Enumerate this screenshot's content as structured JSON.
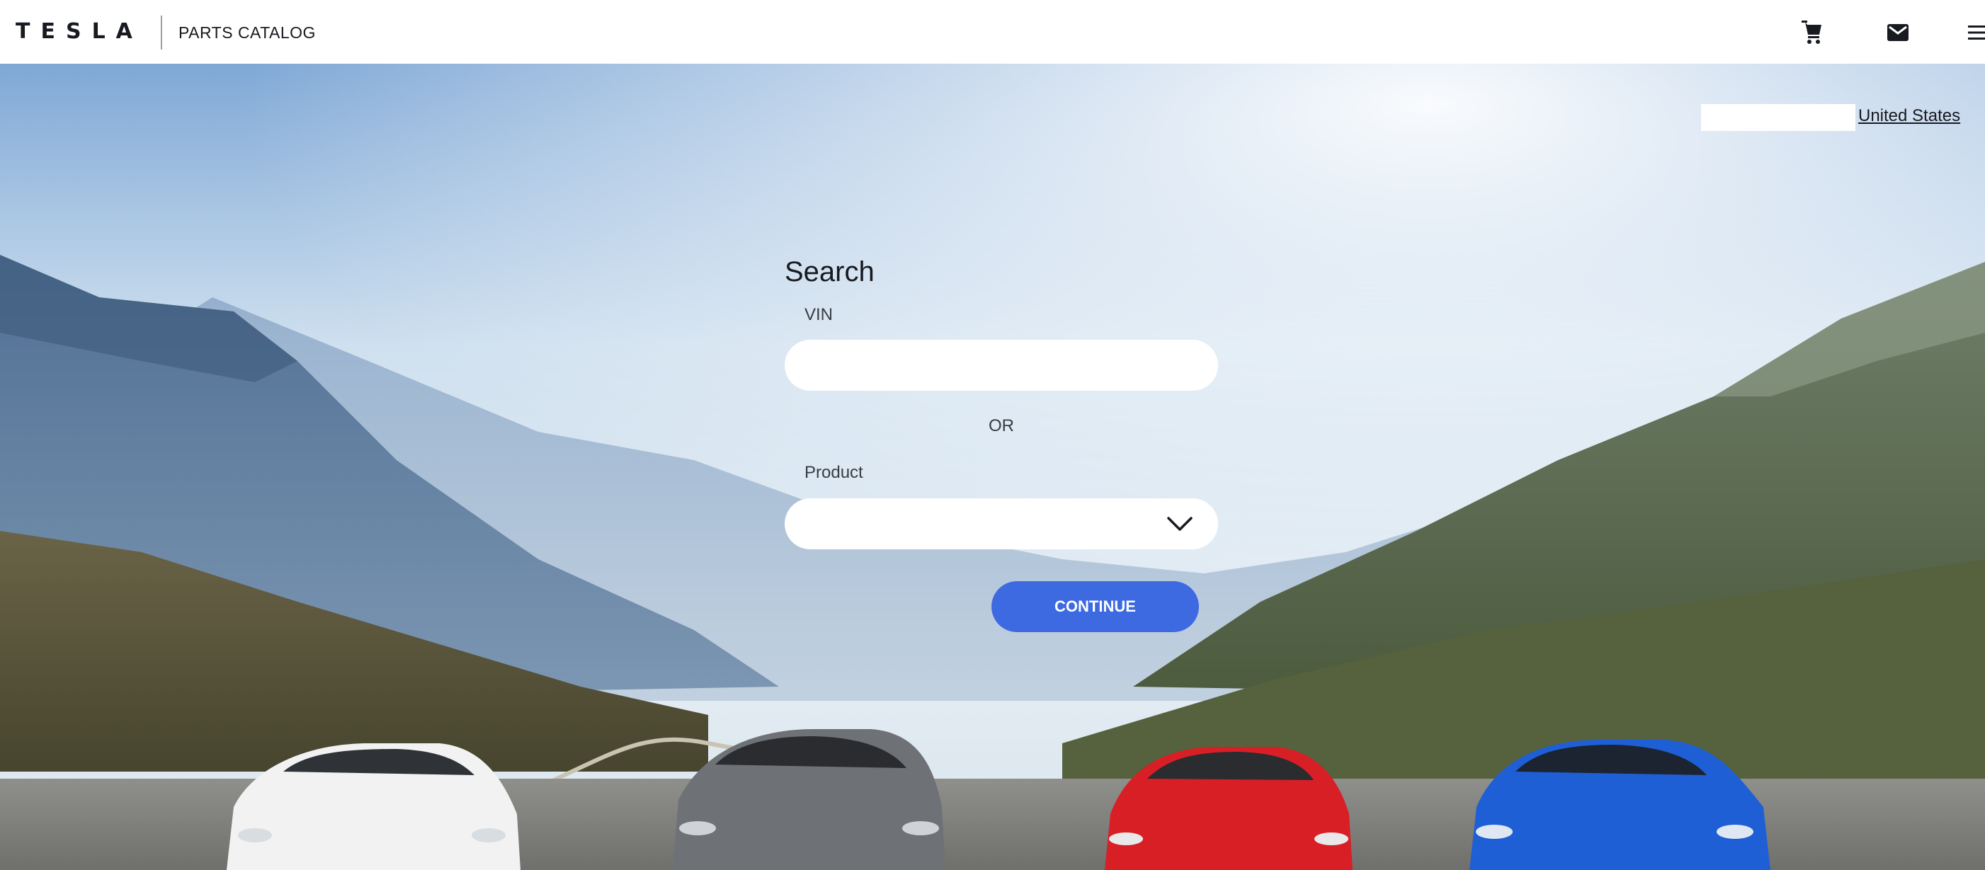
{
  "header": {
    "logo_text": "TESLA",
    "subtitle": "PARTS CATALOG",
    "icons": [
      "cart-icon",
      "mail-icon",
      "menu-icon"
    ]
  },
  "region": {
    "label": "United States"
  },
  "search": {
    "title": "Search",
    "vin_label": "VIN",
    "vin_value": "",
    "vin_placeholder": "",
    "or_text": "OR",
    "product_label": "Product",
    "product_value": "",
    "continue_label": "CONTINUE"
  },
  "colors": {
    "accent": "#3e6ae1",
    "text": "#171a20",
    "header_bg": "#ffffff"
  }
}
